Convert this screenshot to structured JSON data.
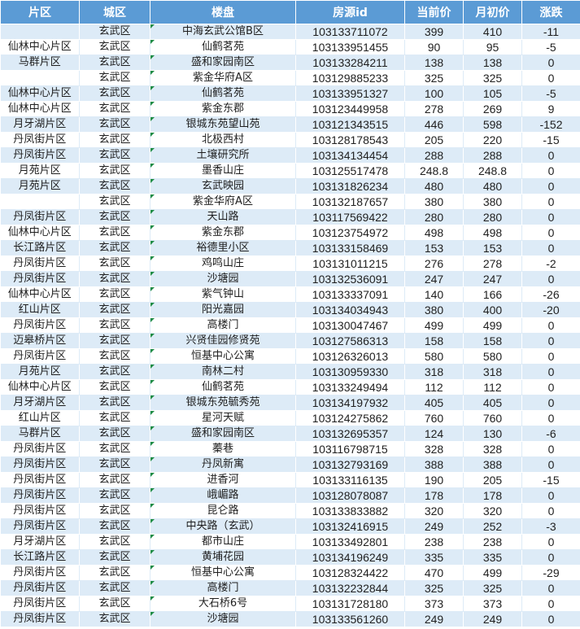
{
  "headers": [
    "片区",
    "城区",
    "楼盘",
    "房源id",
    "当前价",
    "月初价",
    "涨跌"
  ],
  "rows": [
    [
      "",
      "玄武区",
      "中海玄武公馆B区",
      "103133711072",
      "399",
      "410",
      "-11"
    ],
    [
      "仙林中心片区",
      "玄武区",
      "仙鹤茗苑",
      "103133951455",
      "90",
      "95",
      "-5"
    ],
    [
      "马群片区",
      "玄武区",
      "盛和家园南区",
      "103133284211",
      "138",
      "138",
      "0"
    ],
    [
      "",
      "玄武区",
      "紫金华府A区",
      "103129885233",
      "325",
      "325",
      "0"
    ],
    [
      "仙林中心片区",
      "玄武区",
      "仙鹤茗苑",
      "103133951327",
      "100",
      "105",
      "-5"
    ],
    [
      "仙林中心片区",
      "玄武区",
      "紫金东郡",
      "103123449958",
      "278",
      "269",
      "9"
    ],
    [
      "月牙湖片区",
      "玄武区",
      "银城东苑望山苑",
      "103121343515",
      "446",
      "598",
      "-152"
    ],
    [
      "丹凤街片区",
      "玄武区",
      "北极西村",
      "103128178543",
      "205",
      "220",
      "-15"
    ],
    [
      "丹凤街片区",
      "玄武区",
      "土壤研究所",
      "103134134454",
      "288",
      "288",
      "0"
    ],
    [
      "月苑片区",
      "玄武区",
      "墨香山庄",
      "103125517478",
      "248.8",
      "248.8",
      "0"
    ],
    [
      "月苑片区",
      "玄武区",
      "玄武映园",
      "103131826234",
      "480",
      "480",
      "0"
    ],
    [
      "",
      "玄武区",
      "紫金华府A区",
      "103132187657",
      "380",
      "380",
      "0"
    ],
    [
      "丹凤街片区",
      "玄武区",
      "天山路",
      "103117569422",
      "280",
      "280",
      "0"
    ],
    [
      "仙林中心片区",
      "玄武区",
      "紫金东郡",
      "103123754972",
      "498",
      "498",
      "0"
    ],
    [
      "长江路片区",
      "玄武区",
      "裕德里小区",
      "103133158469",
      "153",
      "153",
      "0"
    ],
    [
      "丹凤街片区",
      "玄武区",
      "鸡鸣山庄",
      "103131011215",
      "276",
      "278",
      "-2"
    ],
    [
      "丹凤街片区",
      "玄武区",
      "沙塘园",
      "103132536091",
      "247",
      "247",
      "0"
    ],
    [
      "仙林中心片区",
      "玄武区",
      "紫气钟山",
      "103133337091",
      "140",
      "166",
      "-26"
    ],
    [
      "红山片区",
      "玄武区",
      "阳光嘉园",
      "103134034943",
      "380",
      "400",
      "-20"
    ],
    [
      "丹凤街片区",
      "玄武区",
      "高楼门",
      "103130047467",
      "499",
      "499",
      "0"
    ],
    [
      "迈皋桥片区",
      "玄武区",
      "兴贤佳园修贤苑",
      "103127586313",
      "158",
      "158",
      "0"
    ],
    [
      "丹凤街片区",
      "玄武区",
      "恒基中心公寓",
      "103126326013",
      "580",
      "580",
      "0"
    ],
    [
      "月苑片区",
      "玄武区",
      "南林二村",
      "103130959330",
      "318",
      "318",
      "0"
    ],
    [
      "仙林中心片区",
      "玄武区",
      "仙鹤茗苑",
      "103133249494",
      "112",
      "112",
      "0"
    ],
    [
      "月牙湖片区",
      "玄武区",
      "银城东苑毓秀苑",
      "103134197932",
      "405",
      "405",
      "0"
    ],
    [
      "红山片区",
      "玄武区",
      "星河天赋",
      "103124275862",
      "760",
      "760",
      "0"
    ],
    [
      "马群片区",
      "玄武区",
      "盛和家园南区",
      "103132695357",
      "124",
      "130",
      "-6"
    ],
    [
      "丹凤街片区",
      "玄武区",
      "蓁巷",
      "103116798715",
      "328",
      "328",
      "0"
    ],
    [
      "丹凤街片区",
      "玄武区",
      "丹凤新寓",
      "103132793169",
      "388",
      "388",
      "0"
    ],
    [
      "丹凤街片区",
      "玄武区",
      "进香河",
      "103133116135",
      "190",
      "205",
      "-15"
    ],
    [
      "丹凤街片区",
      "玄武区",
      "峨嵋路",
      "103128078087",
      "178",
      "178",
      "0"
    ],
    [
      "丹凤街片区",
      "玄武区",
      "昆仑路",
      "103133833882",
      "320",
      "320",
      "0"
    ],
    [
      "丹凤街片区",
      "玄武区",
      "中央路（玄武）",
      "103132416915",
      "249",
      "252",
      "-3"
    ],
    [
      "月牙湖片区",
      "玄武区",
      "都市山庄",
      "103133492801",
      "238",
      "238",
      "0"
    ],
    [
      "长江路片区",
      "玄武区",
      "黄埔花园",
      "103134196249",
      "335",
      "335",
      "0"
    ],
    [
      "丹凤街片区",
      "玄武区",
      "恒基中心公寓",
      "103128324422",
      "470",
      "499",
      "-29"
    ],
    [
      "丹凤街片区",
      "玄武区",
      "高楼门",
      "103132232844",
      "325",
      "325",
      "0"
    ],
    [
      "丹凤街片区",
      "玄武区",
      "大石桥6号",
      "103131728180",
      "373",
      "373",
      "0"
    ],
    [
      "丹凤街片区",
      "玄武区",
      "沙塘园",
      "103133561260",
      "249",
      "249",
      "0"
    ]
  ]
}
